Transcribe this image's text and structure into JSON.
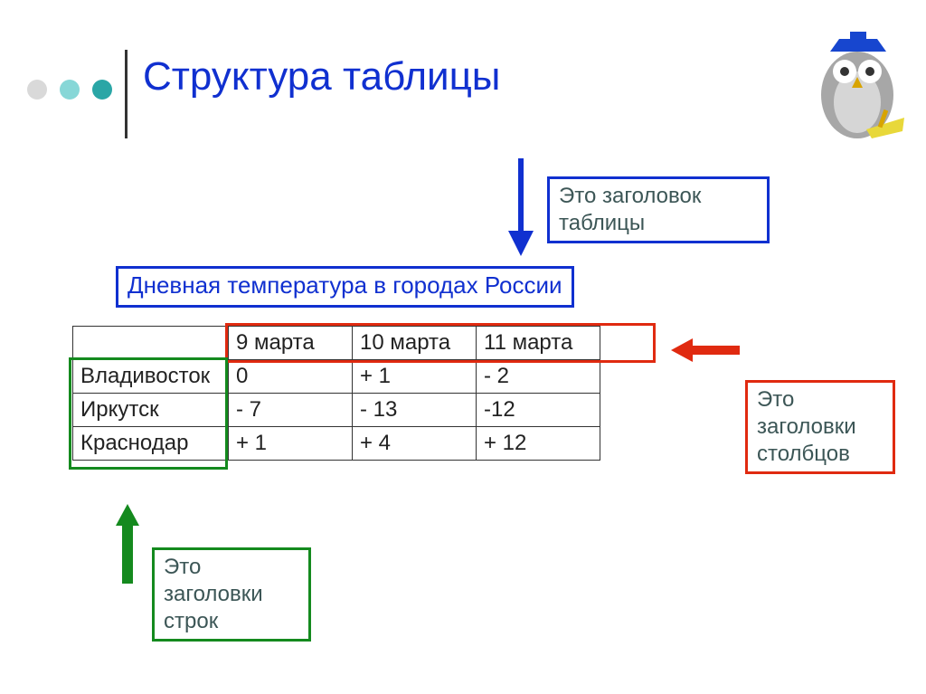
{
  "title": "Структура таблицы",
  "labels": {
    "title_caption": "Это заголовок таблицы",
    "columns_caption": "Это заголовки столбцов",
    "rows_caption": "Это заголовки строк"
  },
  "table_title": "Дневная температура в городах России",
  "chart_data": {
    "type": "table",
    "title": "Дневная температура в городах России",
    "columns": [
      "9 марта",
      "10 марта",
      "11 марта"
    ],
    "rows": [
      "Владивосток",
      "Иркутск",
      "Краснодар"
    ],
    "values": [
      [
        "0",
        "+ 1",
        "- 2"
      ],
      [
        "- 7",
        "- 13",
        "-12"
      ],
      [
        "+ 1",
        "+ 4",
        "+ 12"
      ]
    ]
  }
}
